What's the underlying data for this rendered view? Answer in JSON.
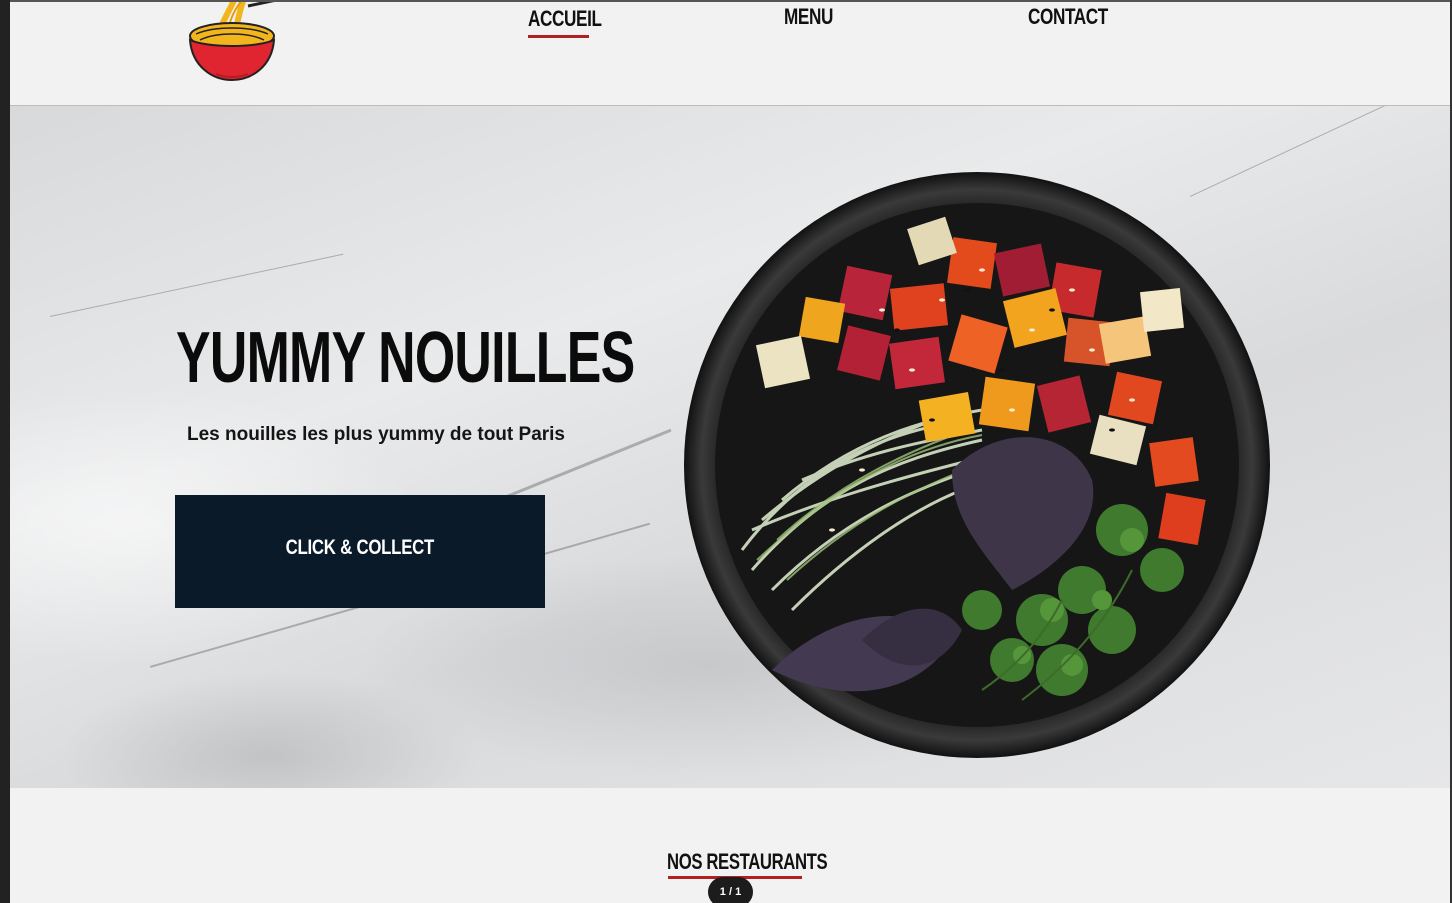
{
  "nav": {
    "items": [
      {
        "label": "ACCUEIL",
        "active": true
      },
      {
        "label": "MENU",
        "active": false
      },
      {
        "label": "CONTACT",
        "active": false
      }
    ]
  },
  "hero": {
    "title": "YUMMY NOUILLES",
    "subtitle": "Les nouilles les plus yummy de tout Paris",
    "cta_label": "CLICK & COLLECT"
  },
  "restaurants": {
    "title": "NOS RESTAURANTS",
    "pager": "1 / 1"
  },
  "colors": {
    "accent": "#b0211f",
    "cta_background": "#0a1a28",
    "page_background": "#f2f2f2"
  },
  "icons": {
    "logo": "noodle-bowl-logo-icon"
  }
}
